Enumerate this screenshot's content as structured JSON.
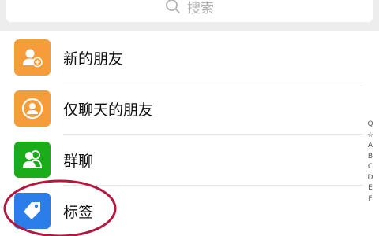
{
  "search": {
    "placeholder": "搜索"
  },
  "contacts": {
    "items": [
      {
        "label": "新的朋友",
        "icon": "new-friend-icon",
        "color": "#f59c3b"
      },
      {
        "label": "仅聊天的朋友",
        "icon": "chat-only-friend-icon",
        "color": "#f59c3b"
      },
      {
        "label": "群聊",
        "icon": "group-chat-icon",
        "color": "#1aad19"
      },
      {
        "label": "标签",
        "icon": "tag-icon",
        "color": "#2b7de9"
      }
    ]
  },
  "index_bar": [
    "Q",
    "☆",
    "A",
    "B",
    "C",
    "D",
    "E",
    "F"
  ],
  "annotation": {
    "color": "#b2183e"
  }
}
